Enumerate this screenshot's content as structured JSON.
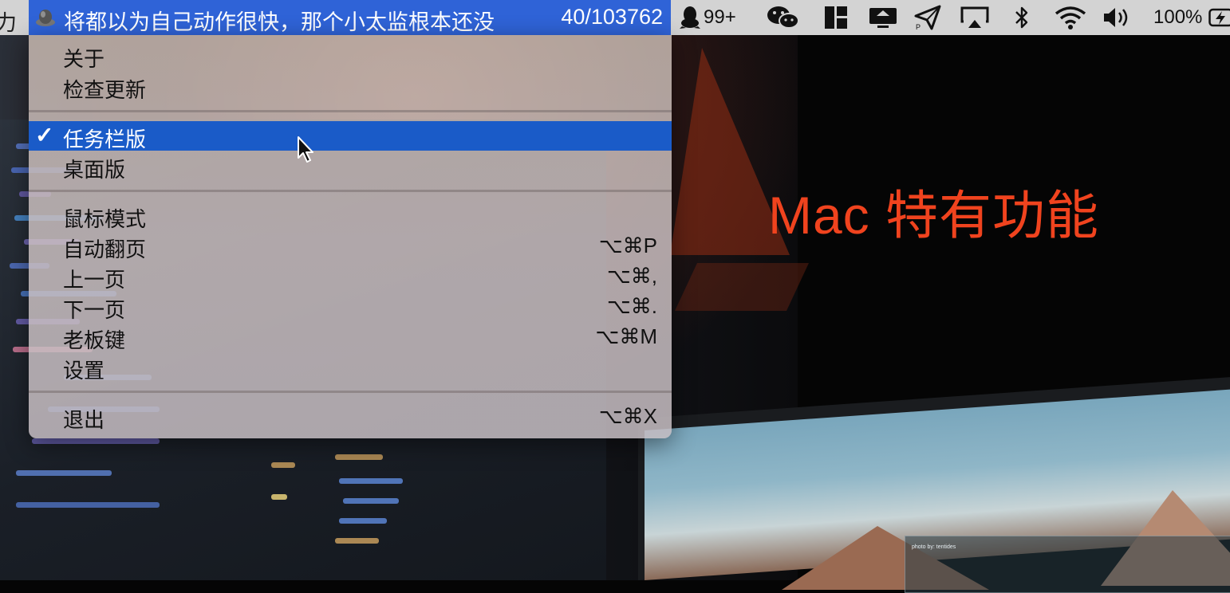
{
  "status_item": {
    "text": "将都以为自己动作很快，那个小太监根本还没",
    "count": "40/103762"
  },
  "tray": {
    "qq_badge": "99+",
    "battery": "100%",
    "icons": [
      "qq-icon",
      "wechat-icon",
      "window-layout-icon",
      "screen-share-icon",
      "paper-plane-icon",
      "airplay-icon",
      "bluetooth-icon",
      "wifi-icon",
      "volume-icon",
      "battery-icon"
    ]
  },
  "menu": {
    "groups": [
      [
        {
          "label": "关于",
          "shortcut": ""
        },
        {
          "label": "检查更新",
          "shortcut": ""
        }
      ],
      [
        {
          "label": "任务栏版",
          "shortcut": "",
          "checked": true,
          "selected": true
        },
        {
          "label": "桌面版",
          "shortcut": ""
        }
      ],
      [
        {
          "label": "鼠标模式",
          "shortcut": ""
        },
        {
          "label": "自动翻页",
          "shortcut": "⌥⌘P"
        },
        {
          "label": "上一页",
          "shortcut": "⌥⌘,"
        },
        {
          "label": "下一页",
          "shortcut": "⌥⌘."
        },
        {
          "label": "老板键",
          "shortcut": "⌥⌘M"
        },
        {
          "label": "设置",
          "shortcut": ""
        }
      ],
      [
        {
          "label": "退出",
          "shortcut": "⌥⌘X"
        }
      ]
    ],
    "checkmark": "✓"
  },
  "promo": {
    "text": "Mac 特有功能"
  },
  "wallpaper": {
    "photo_credit": "photo by: tentides"
  },
  "colors": {
    "selection": "#1a5bc8",
    "status_item_bg": "#2f63d7",
    "promo": "#f0431e",
    "menubar": "#d3d3d3"
  }
}
